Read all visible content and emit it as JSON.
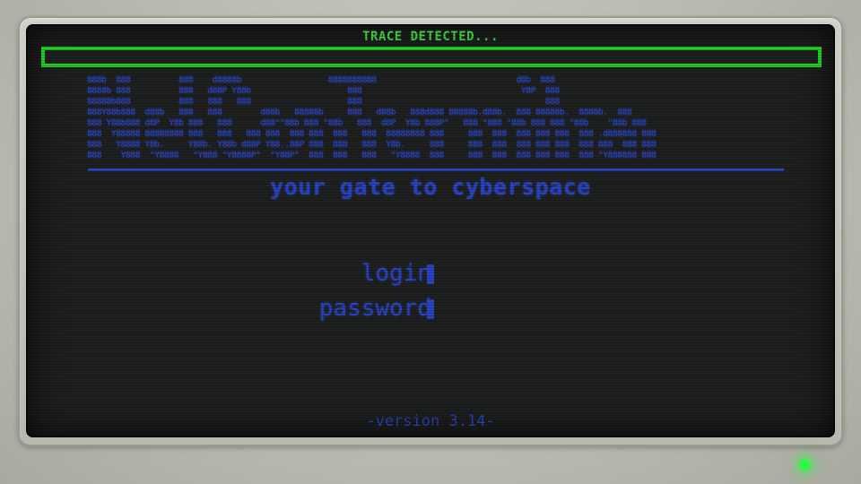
{
  "status": {
    "trace_text": "TRACE DETECTED...",
    "trace_color": "#1fd11f"
  },
  "banner": {
    "ascii_art": "888b  888          888    d8888b                  8888888888                             d8b  888\n8888b 888          888   d88P Y88b                    888                                 Y8P  888\n88888b888          888   888   888                    888                                      888\n888Y88b888  d88b   888   888        d88b   88888b     888   d88b   888d888 88888b.d88b.  888 88888b.  8888b.  888\n888 Y88b888 d8P  Y8b 888   888      d88\"\"88b 888 \"88b   888  d8P  Y8b 888P\"   888 \"888 \"88b 888 888 \"88b    \"88b 888\n888  Y88888 88888888 888   888   888 888  888 888  888   888  88888888 888     888  888  888 888 888  888 .d888888 888\n888   Y8888 Y8b.     Y88b. Y88b d88P Y88..88P 888  888   888  Y8b.     888     888  888  888 888 888  888 888  888 888\n888    Y888  \"Y8888   \"Y888 \"Y8888P\"  \"Y88P\"  888  888   888   \"Y8888  888     888  888  888 888 888  888 \"Y888888 888",
    "tagline": "your gate to cyberspace"
  },
  "login_form": {
    "login_label": "login",
    "password_label": "password"
  },
  "footer": {
    "version": "-version 3.14-"
  },
  "colors": {
    "text": "#2a45c4",
    "screen": "#1f2120",
    "led": "#22ff3a"
  }
}
